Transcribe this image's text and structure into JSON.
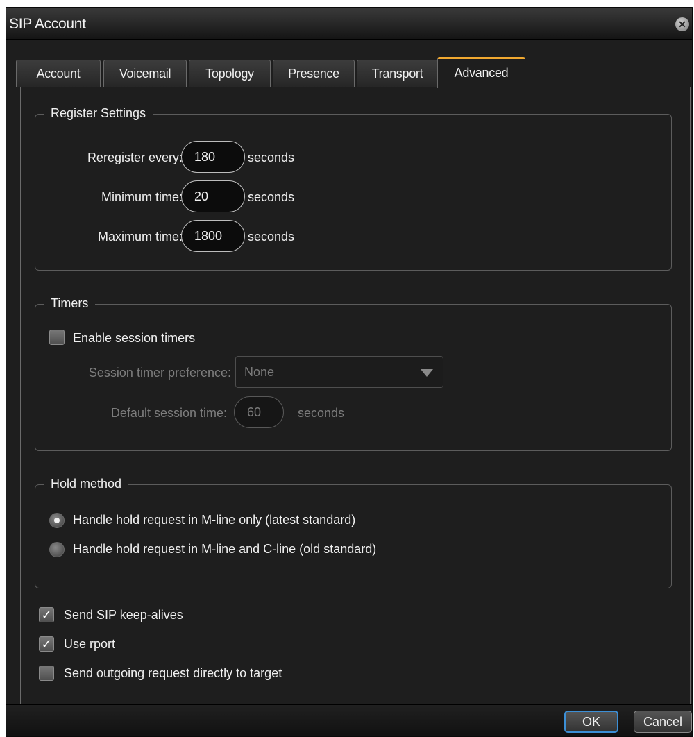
{
  "window": {
    "title": "SIP Account"
  },
  "tabs": [
    {
      "label": "Account"
    },
    {
      "label": "Voicemail"
    },
    {
      "label": "Topology"
    },
    {
      "label": "Presence"
    },
    {
      "label": "Transport"
    },
    {
      "label": "Advanced",
      "active": true
    }
  ],
  "register": {
    "legend": "Register Settings",
    "reregister": {
      "label": "Reregister every:",
      "value": "180",
      "unit": "seconds"
    },
    "minimum": {
      "label": "Minimum time:",
      "value": "20",
      "unit": "seconds"
    },
    "maximum": {
      "label": "Maximum time:",
      "value": "1800",
      "unit": "seconds"
    }
  },
  "timers": {
    "legend": "Timers",
    "enable": {
      "label": "Enable session timers",
      "checked": false
    },
    "preference": {
      "label": "Session timer preference:",
      "value": "None"
    },
    "default_time": {
      "label": "Default session time:",
      "value": "60",
      "unit": "seconds"
    }
  },
  "hold": {
    "legend": "Hold method",
    "options": [
      {
        "label": "Handle hold request in M-line only (latest standard)",
        "checked": true
      },
      {
        "label": "Handle hold request in M-line and C-line (old standard)",
        "checked": false
      }
    ]
  },
  "options": [
    {
      "label": "Send SIP keep-alives",
      "checked": true
    },
    {
      "label": "Use rport",
      "checked": true
    },
    {
      "label": "Send outgoing request directly to target",
      "checked": false
    }
  ],
  "buttons": {
    "ok": "OK",
    "cancel": "Cancel"
  },
  "icons": {
    "close": "close-icon",
    "dropdown": "chevron-down-icon",
    "check": "checkmark-icon"
  },
  "colors": {
    "accent_tab": "#f0a830",
    "default_button_border": "#3c8fd6",
    "background": "#1e1e1e"
  }
}
